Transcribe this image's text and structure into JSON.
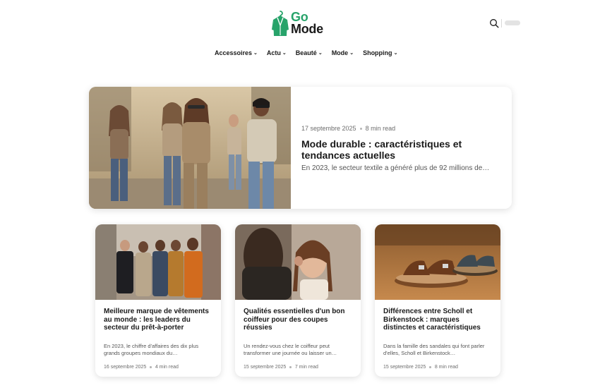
{
  "brand": {
    "line1": "Go",
    "line2": "Mode",
    "accent_color": "#27a36a",
    "icon": "clothes-hanger-shirt-icon"
  },
  "header": {
    "search_icon": "search-icon"
  },
  "nav": {
    "items": [
      {
        "label": "Accessoires",
        "icon": "chevron-down-icon"
      },
      {
        "label": "Actu",
        "icon": "chevron-down-icon"
      },
      {
        "label": "Beauté",
        "icon": "chevron-down-icon"
      },
      {
        "label": "Mode",
        "icon": "chevron-down-icon"
      },
      {
        "label": "Shopping",
        "icon": "chevron-down-icon"
      }
    ]
  },
  "featured": {
    "date": "17 septembre 2025",
    "read_time": "8 min read",
    "title": "Mode durable : caractéristiques et tendances actuelles",
    "excerpt": "En 2023, le secteur textile a généré plus de 92 millions de…"
  },
  "cards": [
    {
      "title": "Meilleure marque de vêtements au monde : les leaders du secteur du prêt-à-porter",
      "excerpt": "En 2023, le chiffre d'affaires des dix plus grands groupes mondiaux du…",
      "date": "16 septembre 2025",
      "read_time": "4 min read"
    },
    {
      "title": "Qualités essentielles d'un bon coiffeur pour des coupes réussies",
      "excerpt": "Un rendez-vous chez le coiffeur peut transformer une journée ou laisser un…",
      "date": "15 septembre 2025",
      "read_time": "7 min read"
    },
    {
      "title": "Différences entre Scholl et Birkenstock : marques distinctes et caractéristiques",
      "excerpt": "Dans la famille des sandales qui font parler d'elles, Scholl et Birkenstock…",
      "date": "15 septembre 2025",
      "read_time": "8 min read"
    }
  ]
}
